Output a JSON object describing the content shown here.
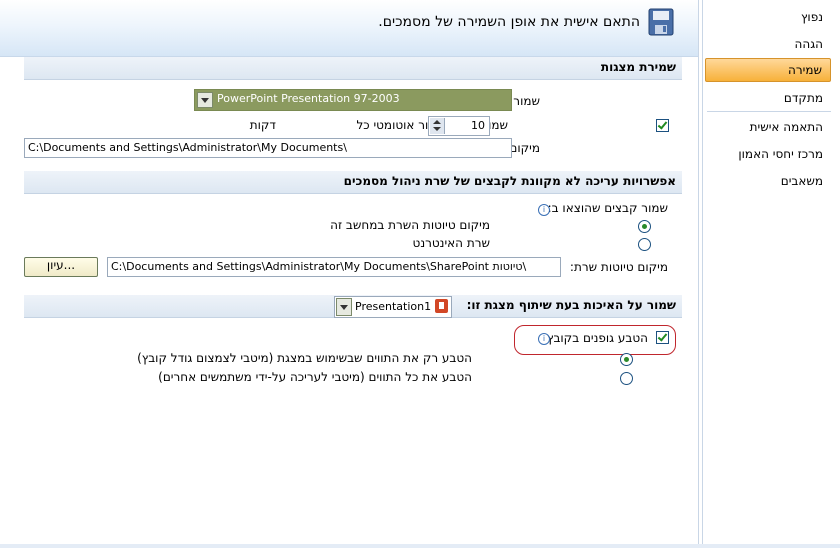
{
  "header": {
    "title": "התאם אישית את אופן השמירה של מסמכים."
  },
  "section_save": {
    "title": "שמירת מצגות",
    "format_label": "שמור קבצים בתבנית זו:",
    "format_value": "PowerPoint Presentation 97-2003",
    "autorecover_label": "שמור מידע שחזור אוטומטי כל",
    "autorecover_value": "10",
    "autorecover_unit": "דקות",
    "autorecover_checked": true,
    "default_location_label": "מיקום ברירת מחדל לקבצים:",
    "default_location_value": "C:\\Documents and Settings\\Administrator\\My Documents\\"
  },
  "section_offline": {
    "title": "אפשרויות עריכה לא מקוונת לקבצים של שרת ניהול מסמכים",
    "checkout_label": "שמור קבצים שהוצאו ב:",
    "option_local": "מיקום טיוטות השרת במחשב זה",
    "option_web": "שרת האינטרנט",
    "drafts_label": "מיקום טיוטות שרת:",
    "drafts_value": "C:\\Documents and Settings\\Administrator\\My Documents\\SharePoint טיוטות\\",
    "browse_label": "עיון..."
  },
  "section_fidelity": {
    "title": "שמור על האיכות בעת שיתוף מצגת זו:",
    "presentation_value": "Presentation1",
    "embed_fonts_label": "הטבע גופנים בקובץ",
    "embed_fonts_checked": true,
    "option_used_chars": "הטבע רק את התווים שבשימוש במצגת (מיטבי לצמצום גודל קובץ)",
    "option_all_chars": "הטבע את כל התווים (מיטבי לעריכה על-ידי משתמשים אחרים)"
  },
  "sidebar": {
    "items": [
      "נפוץ",
      "הגהה",
      "שמירה",
      "מתקדם",
      "התאמה אישית",
      "מרכז יחסי האמון",
      "משאבים"
    ],
    "selected": "שמירה"
  },
  "colors": {
    "section_bg": "#dde7f2",
    "selected_nav": "#f7b13a",
    "highlight_ring": "#c0262d",
    "combo_bg": "#8b9a5f"
  }
}
